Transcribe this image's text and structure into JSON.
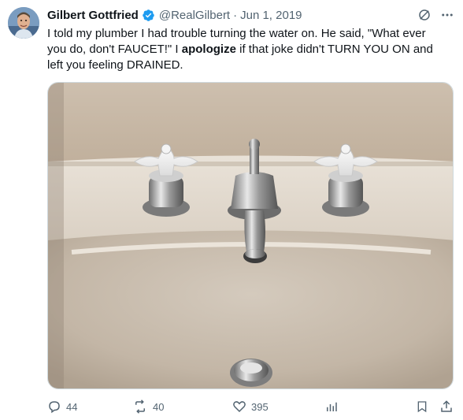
{
  "tweet": {
    "author_name": "Gilbert Gottfried",
    "handle": "@RealGilbert",
    "separator": "·",
    "date": "Jun 1, 2019",
    "text_line1_part1": "I told my plumber I had trouble turning the water on.  He said, \"What ever",
    "text_line2": "you do, don't FAUCET!\"  I ",
    "text_bold": "apologize",
    "text_line2_rest": " if that joke didn't TURN YOU ON and",
    "text_line3": "left you feeling DRAINED.",
    "media_description_icon": "photo-of-bathroom-sink-with-faucet"
  },
  "actions": {
    "replies": "44",
    "reposts": "40",
    "likes": "395"
  },
  "colors": {
    "text": "#0f1419",
    "secondary": "#536471",
    "verified": "#1d9bf0",
    "border": "#cfd9de"
  }
}
